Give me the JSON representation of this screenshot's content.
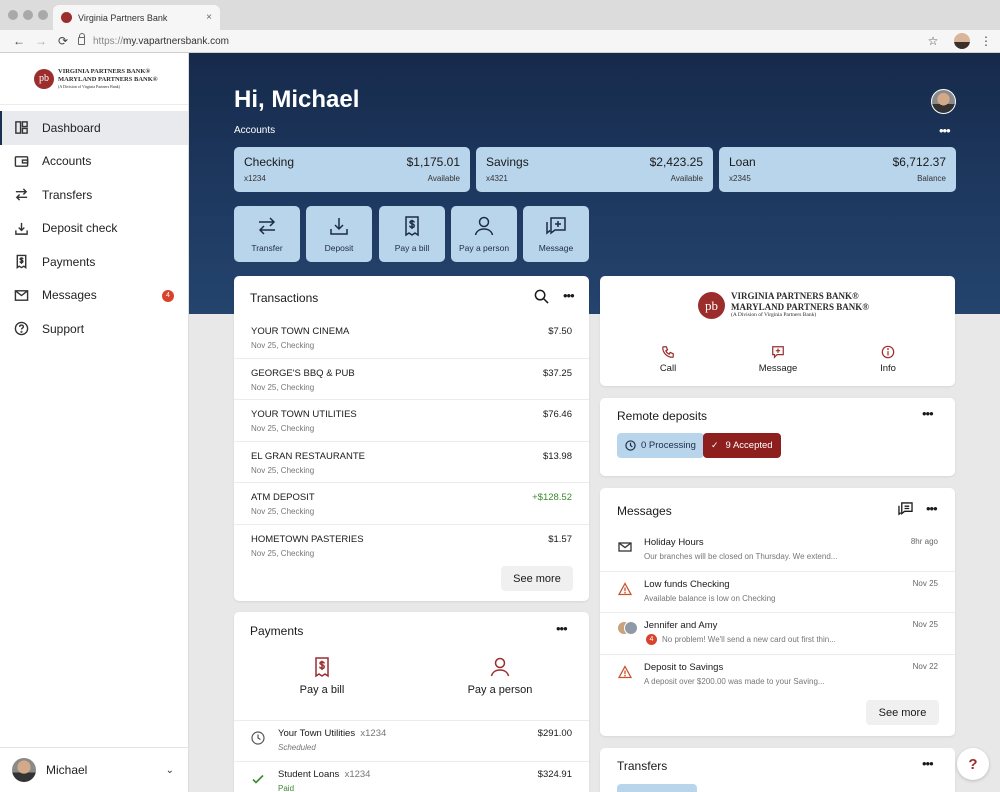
{
  "browser": {
    "tab_title": "Virginia Partners Bank",
    "tab_close": "×",
    "url_protocol": "https://",
    "url_host": "my.vapartnersbank.com",
    "back": "←",
    "forward": "→",
    "reload": "⟳",
    "star": "☆",
    "menu": "⋮"
  },
  "brand": {
    "monogram": "pb",
    "line1": "VIRGINIA PARTNERS BANK®",
    "line2": "MARYLAND PARTNERS BANK®",
    "line3": "(A Division of Virginia Partners Bank)"
  },
  "sidebar": {
    "items": [
      {
        "label": "Dashboard",
        "icon": "dashboard-icon"
      },
      {
        "label": "Accounts",
        "icon": "wallet-icon"
      },
      {
        "label": "Transfers",
        "icon": "transfer-icon"
      },
      {
        "label": "Deposit check",
        "icon": "download-icon"
      },
      {
        "label": "Payments",
        "icon": "bill-icon"
      },
      {
        "label": "Messages",
        "icon": "mail-icon",
        "badge": "4"
      },
      {
        "label": "Support",
        "icon": "help-icon"
      }
    ],
    "user_name": "Michael",
    "user_chevron": "⌄"
  },
  "hero": {
    "greeting": "Hi, Michael",
    "accounts_label": "Accounts",
    "more": "•••"
  },
  "accounts": [
    {
      "name": "Checking",
      "number": "x1234",
      "amount": "$1,175.01",
      "kind": "Available"
    },
    {
      "name": "Savings",
      "number": "x4321",
      "amount": "$2,423.25",
      "kind": "Available"
    },
    {
      "name": "Loan",
      "number": "x2345",
      "amount": "$6,712.37",
      "kind": "Balance"
    }
  ],
  "quick_actions": [
    "Transfer",
    "Deposit",
    "Pay a bill",
    "Pay a person",
    "Message"
  ],
  "transactions": {
    "title": "Transactions",
    "more": "•••",
    "rows": [
      {
        "name": "YOUR TOWN CINEMA",
        "meta": "Nov 25, Checking",
        "amount": "$7.50"
      },
      {
        "name": "GEORGE'S BBQ & PUB",
        "meta": "Nov 25, Checking",
        "amount": "$37.25"
      },
      {
        "name": "YOUR TOWN UTILITIES",
        "meta": "Nov 25, Checking",
        "amount": "$76.46"
      },
      {
        "name": "EL GRAN RESTAURANTE",
        "meta": "Nov 25, Checking",
        "amount": "$13.98"
      },
      {
        "name": "ATM DEPOSIT",
        "meta": "Nov 25, Checking",
        "amount": "+$128.52"
      },
      {
        "name": "HOMETOWN PASTERIES",
        "meta": "Nov 25, Checking",
        "amount": "$1.57"
      }
    ],
    "see_more": "See more"
  },
  "contact": {
    "call": "Call",
    "message": "Message",
    "info": "Info"
  },
  "remote_deposits": {
    "title": "Remote deposits",
    "more": "•••",
    "processing": "0 Processing",
    "accepted": "9 Accepted",
    "check": "✓"
  },
  "messages": {
    "title": "Messages",
    "more": "•••",
    "rows": [
      {
        "from": "Holiday Hours",
        "preview": "Our branches will be closed on Thursday. We extend...",
        "when": "8hr ago"
      },
      {
        "from": "Low funds Checking",
        "preview": "Available balance is low on Checking",
        "when": "Nov 25"
      },
      {
        "from": "Jennifer and Amy",
        "preview": "No problem! We'll send a new card out first thin...",
        "when": "Nov 25",
        "badge": "4"
      },
      {
        "from": "Deposit to Savings",
        "preview": "A deposit over $200.00 was made to your Saving...",
        "when": "Nov 22"
      }
    ],
    "see_more": "See more"
  },
  "payments": {
    "title": "Payments",
    "more": "•••",
    "pay_bill": "Pay a bill",
    "pay_person": "Pay a person",
    "rows": [
      {
        "name": "Your Town Utilities",
        "account": "x1234",
        "status": "Scheduled",
        "amount": "$291.00"
      },
      {
        "name": "Student Loans",
        "account": "x1234",
        "status": "Paid",
        "amount": "$324.91"
      }
    ]
  },
  "transfers": {
    "title": "Transfers",
    "more": "•••"
  },
  "help_button": "?",
  "colors": {
    "navy": "#1b2f52",
    "accent_red": "#9b2d2d",
    "card_blue": "#b9d5ec",
    "positive": "#3a8a2e"
  }
}
